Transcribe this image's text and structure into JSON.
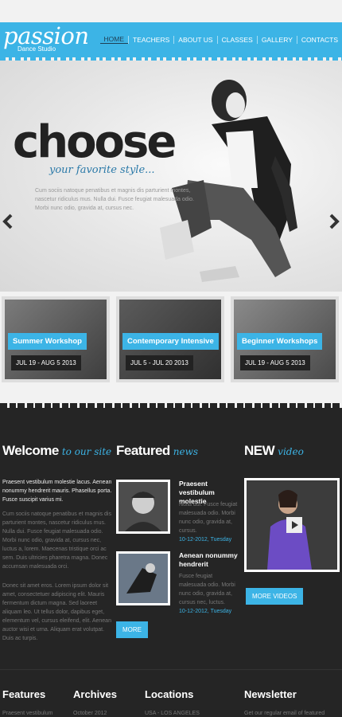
{
  "header": {
    "logo": "passion",
    "tagline": "Dance Studio",
    "nav": [
      "HOME",
      "TEACHERS",
      "ABOUT US",
      "CLASSES",
      "GALLERY",
      "CONTACTS"
    ]
  },
  "hero": {
    "title": "choose",
    "subtitle": "your favorite style...",
    "text": "Cum sociis natoque penatibus et magnis dis parturient montes, nascetur ridiculus mus. Nulla dui. Fusce feugiat malesuada odio. Morbi nunc odio, gravida at, cursus nec."
  },
  "workshops": [
    {
      "title": "Summer Workshop",
      "dates": "JUL 19 - AUG 5 2013"
    },
    {
      "title": "Contemporary Intensive",
      "dates": "JUL 5 - JUL 20 2013"
    },
    {
      "title": "Beginner Workshops",
      "dates": "JUL 19 - AUG 5 2013"
    }
  ],
  "welcome": {
    "heading": "Welcome",
    "heading_em": "to our site",
    "lead": "Praesent vestibulum molestie lacus. Aenean nonummy hendrerit mauris. Phasellus porta. Fusce suscipit varius mi.",
    "p1": "Cum sociis natoque penatibus et magnis dis parturient montes, nascetur ridiculus mus. Nulla dui. Fusce feugiat malesuada odio. Morbi nunc odio, gravida at, cursus nec, luctus a, lorem. Maecenas tristique orci ac sem. Duis ultricies pharetra magna. Donec accumsan malesuada orci.",
    "p2": "Donec sit amet eros. Lorem ipsum dolor sit amet, consectetuer adipiscing elit. Mauris fermentum dictum magna. Sed laoreet aliquam leo. Ut tellus dolor, dapibus eget, elementum vel, cursus eleifend, elit. Aenean auctor wisi et urna. Aliquam erat volutpat. Duis ac turpis."
  },
  "featured": {
    "heading": "Featured",
    "heading_em": "news",
    "items": [
      {
        "title": "Praesent vestibulum molestie",
        "body": "Nulla dui. Fusce feugiat malesuada odio. Morbi nunc odio, gravida at, cursus.",
        "date": "10-12-2012, Tuesday"
      },
      {
        "title": "Aenean nonummy hendrerit",
        "body": "Fusce feugiat malesuada odio. Morbi nunc odio, gravida at, cursus nec, luctus.",
        "date": "10-12-2012, Tuesday"
      }
    ],
    "button": "MORE"
  },
  "video": {
    "heading": "NEW",
    "heading_em": "video",
    "button": "MORE VIDEOS"
  },
  "footer": {
    "features": {
      "heading": "Features",
      "item": "Praesent vestibulum"
    },
    "archives": {
      "heading": "Archives",
      "item": "October 2012"
    },
    "locations": {
      "heading": "Locations",
      "item": "USA - LOS ANGELES"
    },
    "newsletter": {
      "heading": "Newsletter",
      "item": "Get our regular email of featured"
    }
  },
  "colors": {
    "accent": "#3cb4e6",
    "dark_bg": "#252525",
    "date_bg": "#222222"
  }
}
